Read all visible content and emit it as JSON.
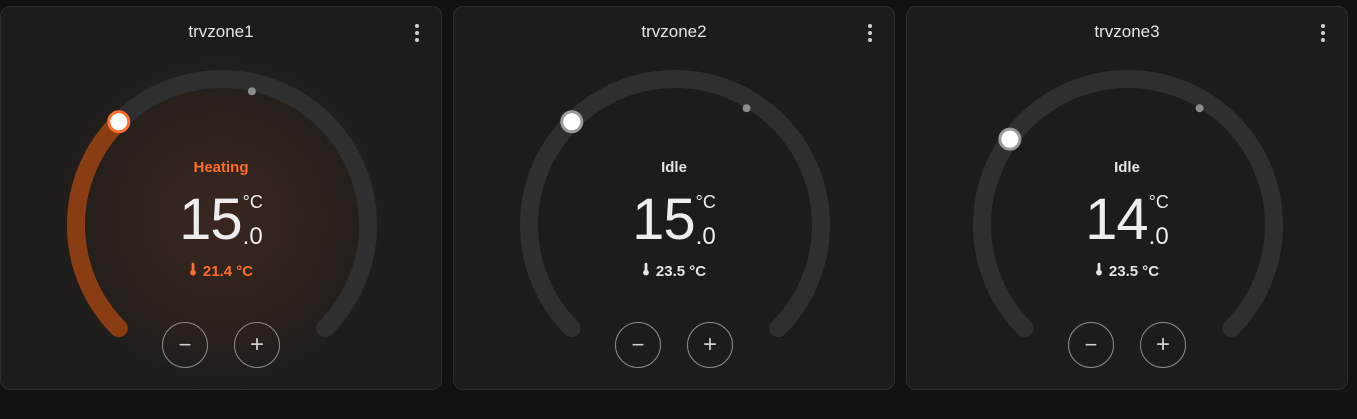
{
  "colors": {
    "page_bg": "#111111",
    "card_bg": "#1c1c1c",
    "track": "#2f2f2f",
    "heating": "#ff6d2b",
    "heating_arc": "#8a3d12",
    "idle_text": "#e4e4e4",
    "handle": "#ffffff"
  },
  "cards": [
    {
      "title": "trvzone1",
      "hvac_action": "Heating",
      "mode": "heating",
      "target_integer": "15",
      "target_decimal": ".0",
      "unit": "°C",
      "current_temperature": "21.4 °C",
      "target_value": 15.0,
      "current_value": 21.4,
      "min_temp": 5,
      "max_temp": 35,
      "decrease_label": "−",
      "increase_label": "+"
    },
    {
      "title": "trvzone2",
      "hvac_action": "Idle",
      "mode": "idle",
      "target_integer": "15",
      "target_decimal": ".0",
      "unit": "°C",
      "current_temperature": "23.5 °C",
      "target_value": 15.0,
      "current_value": 23.5,
      "min_temp": 5,
      "max_temp": 35,
      "decrease_label": "−",
      "increase_label": "+"
    },
    {
      "title": "trvzone3",
      "hvac_action": "Idle",
      "mode": "idle",
      "target_integer": "14",
      "target_decimal": ".0",
      "unit": "°C",
      "current_temperature": "23.5 °C",
      "target_value": 14.0,
      "current_value": 23.5,
      "min_temp": 5,
      "max_temp": 35,
      "decrease_label": "−",
      "increase_label": "+"
    }
  ]
}
